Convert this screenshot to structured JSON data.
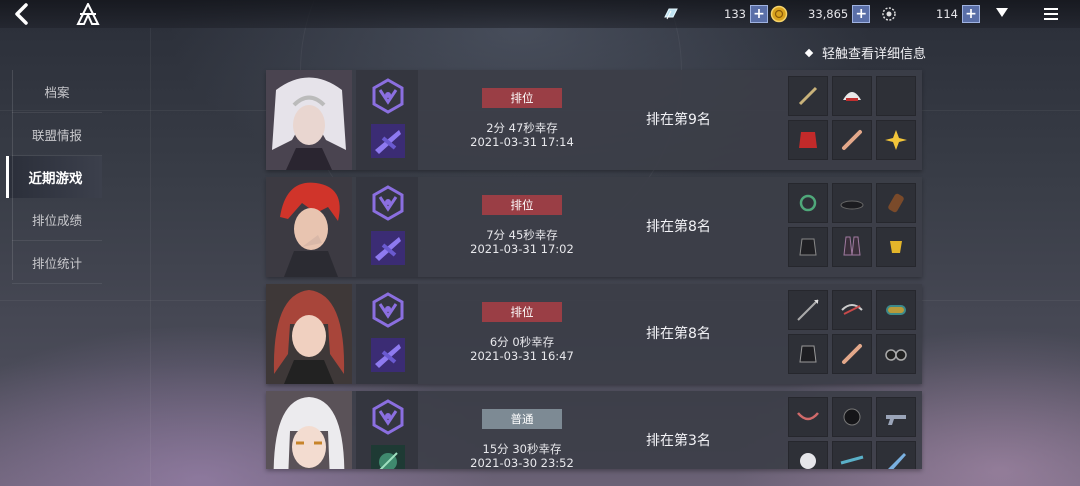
{
  "topbar": {
    "back_label": "back",
    "currencies": [
      {
        "name": "crystal",
        "value": "133"
      },
      {
        "name": "coin",
        "value": "33,865"
      },
      {
        "name": "credit",
        "value": "114"
      }
    ],
    "plus": "+"
  },
  "hint": "轻触查看详细信息",
  "sidebar": {
    "items": [
      {
        "label": "档案"
      },
      {
        "label": "联盟情报"
      },
      {
        "label": "近期游戏"
      },
      {
        "label": "排位成绩"
      },
      {
        "label": "排位统计"
      }
    ]
  },
  "matches": [
    {
      "mode": "排位",
      "survive": "2分 47秒幸存",
      "date": "2021-03-31 17:14",
      "rank": "排在第9名",
      "items": [
        "wand",
        "helmet",
        "",
        "red-armor",
        "bone",
        "flower"
      ]
    },
    {
      "mode": "排位",
      "survive": "7分 45秒幸存",
      "date": "2021-03-31 17:02",
      "rank": "排在第8名",
      "items": [
        "necklace",
        "hat",
        "arm-guard",
        "black-armor",
        "boots",
        "gold-trinket"
      ]
    },
    {
      "mode": "排位",
      "survive": "6分 0秒幸存",
      "date": "2021-03-31 16:47",
      "rank": "排在第8名",
      "items": [
        "spear",
        "crossbow-helmet",
        "bracelet",
        "black-coat",
        "bone",
        "binoculars"
      ]
    },
    {
      "mode": "普通",
      "survive": "15分 30秒幸存",
      "date": "2021-03-30 23:52",
      "rank": "排在第3名",
      "items": [
        "bow",
        "dark-helmet",
        "gun",
        "white-item",
        "rifle",
        "blade"
      ]
    }
  ],
  "colors": {
    "ranked": "#9a3e45",
    "normal": "#7d8a94",
    "plus": "#5a6fa8"
  }
}
